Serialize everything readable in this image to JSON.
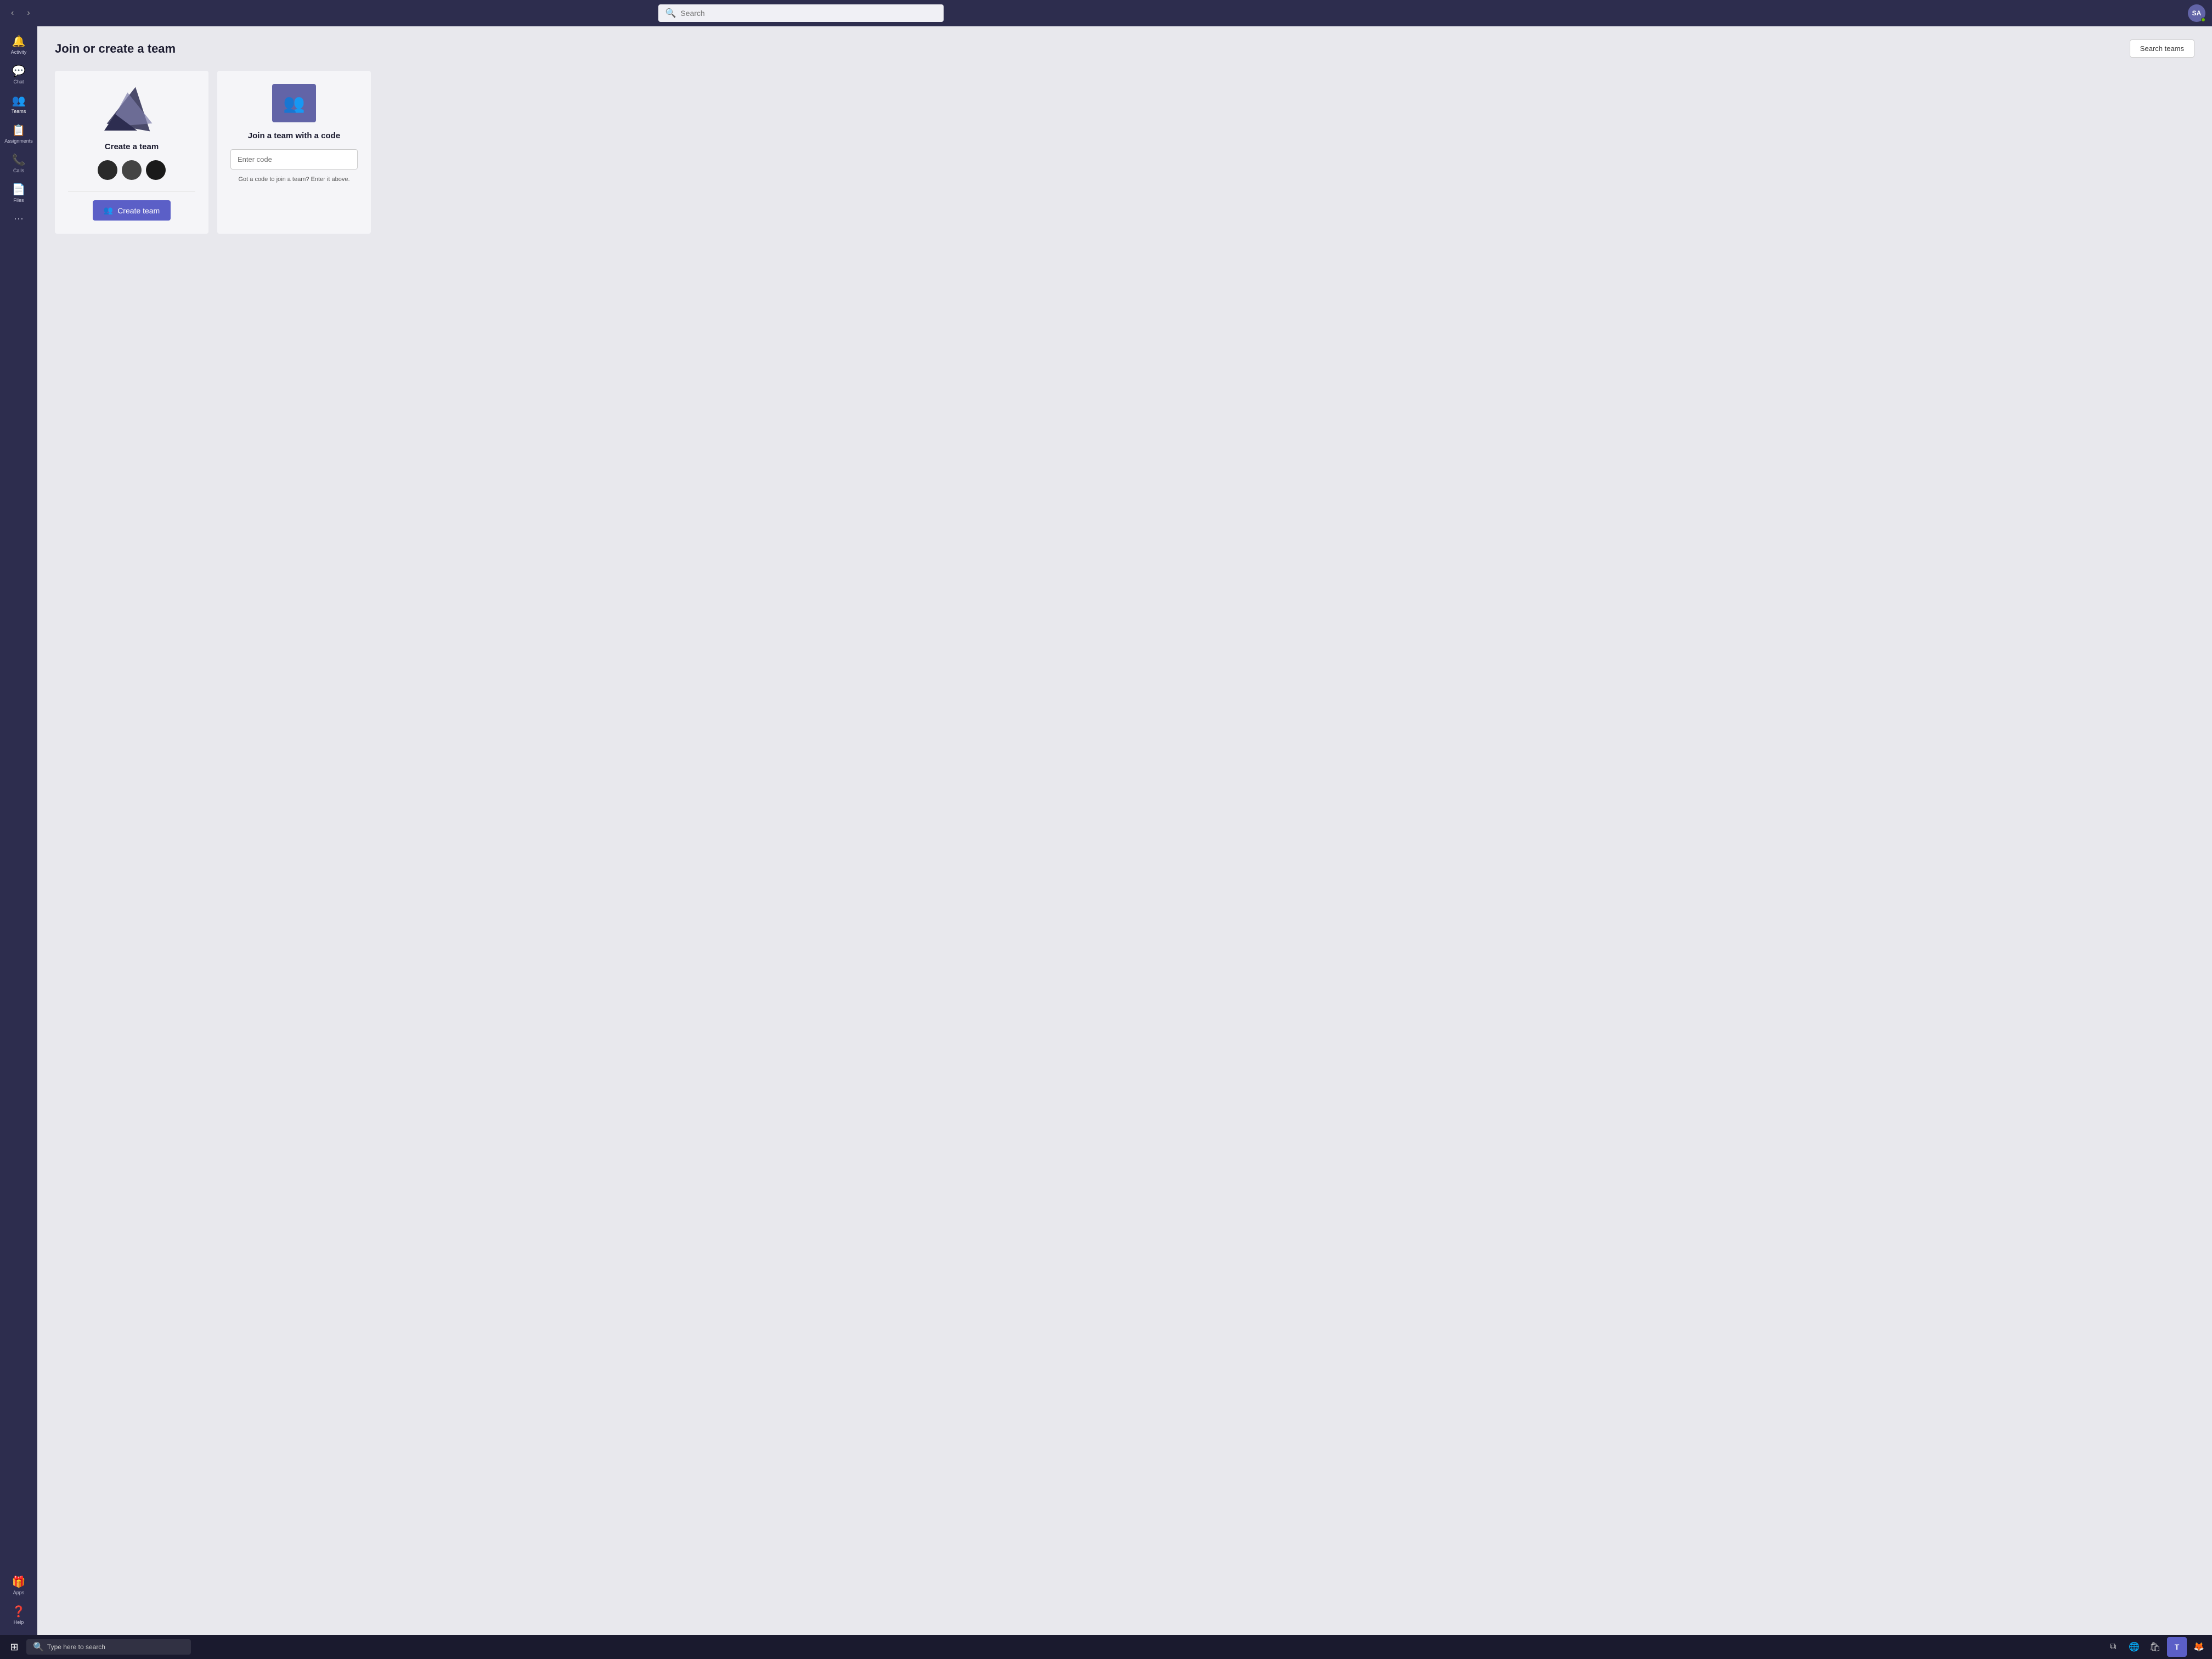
{
  "titlebar": {
    "nav_back": "‹",
    "nav_forward": "›",
    "search_placeholder": "Search",
    "avatar_initials": "SA"
  },
  "sidebar": {
    "items": [
      {
        "id": "activity",
        "icon": "🔔",
        "label": "Activity"
      },
      {
        "id": "chat",
        "icon": "💬",
        "label": "Chat"
      },
      {
        "id": "teams",
        "icon": "👥",
        "label": "Teams"
      },
      {
        "id": "assignments",
        "icon": "📋",
        "label": "Assignments"
      },
      {
        "id": "calls",
        "icon": "📞",
        "label": "Calls"
      },
      {
        "id": "files",
        "icon": "📄",
        "label": "Files"
      }
    ],
    "more_label": "···",
    "bottom_items": [
      {
        "id": "apps",
        "icon": "🎁",
        "label": "Apps"
      },
      {
        "id": "help",
        "icon": "❓",
        "label": "Help"
      }
    ]
  },
  "page": {
    "title": "Join or create a team",
    "search_teams_btn": "Search teams"
  },
  "create_card": {
    "title": "Create a team",
    "btn_label": "Create team",
    "btn_icon": "👥"
  },
  "join_card": {
    "title": "Join a team with a code",
    "code_placeholder": "Enter code",
    "hint_text": "Got a code to join a team? Enter it above."
  },
  "taskbar": {
    "search_placeholder": "Type here to search",
    "apps": [
      {
        "id": "task-view",
        "icon": "⧉"
      },
      {
        "id": "edge",
        "icon": "🌐"
      },
      {
        "id": "store",
        "icon": "🛍"
      },
      {
        "id": "teams",
        "icon": "T"
      },
      {
        "id": "firefox",
        "icon": "🦊"
      }
    ]
  }
}
